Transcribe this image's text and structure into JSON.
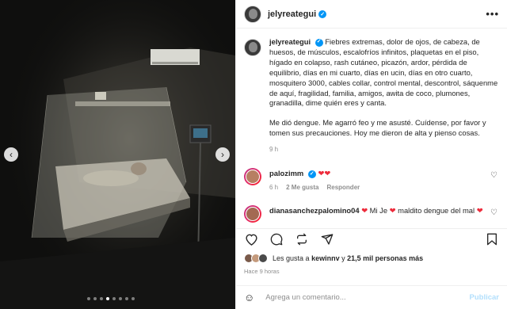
{
  "post": {
    "username": "jelyreategui",
    "verified_mark": "✓",
    "more_icon": "•••"
  },
  "media": {
    "prev_arrow": "‹",
    "next_arrow": "›",
    "dots_total": 8,
    "dot_active_index": 3
  },
  "caption": {
    "username": "jelyreategui",
    "paragraph1": "Fiebres extremas, dolor de ojos, de cabeza, de huesos, de músculos, escalofríos infinitos, plaquetas en el piso, hígado en colapso, rash cutáneo, picazón, ardor, pérdida de equilibrio, días en mi cuarto, días en ucin, días en otro cuarto, mosquitero 3000, cables collar, control mental, descontrol, sáquenme de aquí, fragilidad, familia, amigos, awita de coco, plumones, granadilla, dime quién eres y canta.",
    "paragraph2": "Me dió dengue. Me agarró feo y me asusté. Cuídense, por favor y tomen sus precauciones. Hoy me dieron de alta y pienso cosas.",
    "time": "9 h"
  },
  "comments": [
    {
      "username": "palozimm",
      "text": "",
      "hearts": "❤❤",
      "time": "6 h",
      "likes": "2 Me gusta",
      "reply": "Responder"
    },
    {
      "username": "dianasanchezpalomino04",
      "text_a": "Mi Je",
      "text_b": "maldito dengue del mal",
      "heart": "❤"
    }
  ],
  "likes": {
    "prefix": "Les gusta a",
    "user": "kewinnv",
    "connector": "y",
    "count": "21,5 mil personas más"
  },
  "posted": "Hace 9 horas",
  "add_comment": {
    "placeholder": "Agrega un comentario...",
    "publish": "Publicar"
  },
  "colors": {
    "accent": "#0095f6",
    "heart_red": "#ed2b3b",
    "publish_disabled": "#b2dffc"
  }
}
